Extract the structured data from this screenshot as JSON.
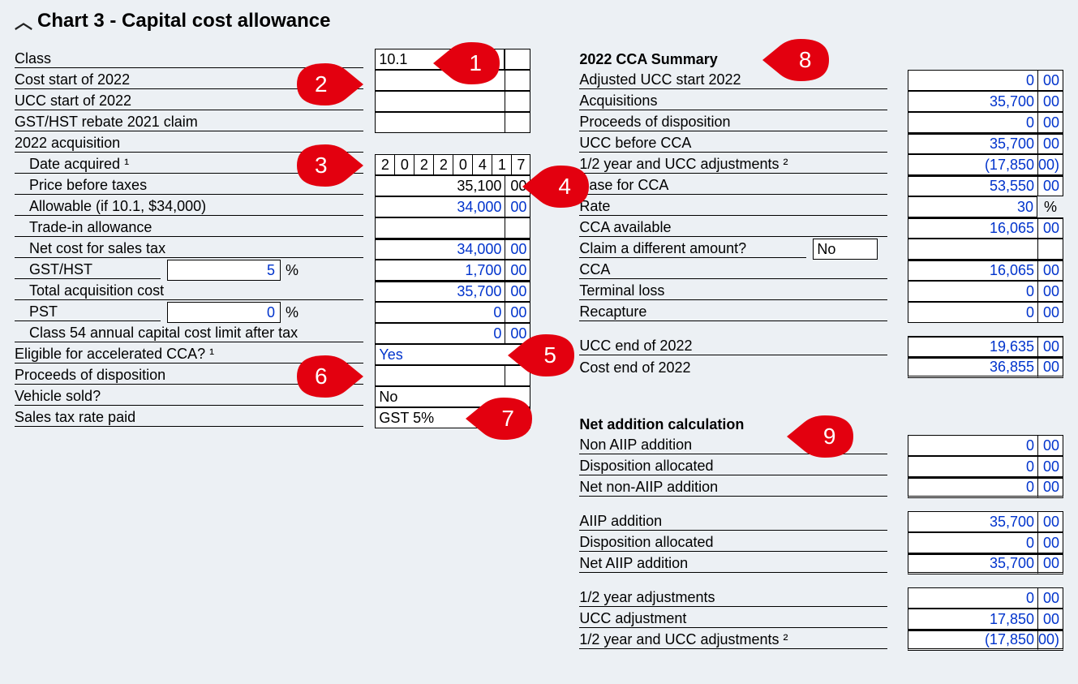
{
  "title": "Chart 3 - Capital cost allowance",
  "left": {
    "class": {
      "label": "Class",
      "value": "10.1"
    },
    "cost_start": {
      "label": "Cost start of 2022",
      "value": "",
      "cents": ""
    },
    "ucc_start": {
      "label": "UCC start of 2022",
      "value": "",
      "cents": ""
    },
    "gst_rebate": {
      "label": "GST/HST rebate 2021 claim",
      "value": "",
      "cents": ""
    },
    "acq_header": "2022 acquisition",
    "date_acquired": {
      "label": "Date acquired ¹",
      "digits": [
        "2",
        "0",
        "2",
        "2",
        "0",
        "4",
        "1",
        "7"
      ]
    },
    "price": {
      "label": "Price before taxes",
      "value": "35,100",
      "cents": "00"
    },
    "allowable": {
      "label": "Allowable (if 10.1, $34,000)",
      "value": "34,000",
      "cents": "00"
    },
    "tradein": {
      "label": "Trade-in allowance",
      "value": "",
      "cents": ""
    },
    "netcost": {
      "label": "Net cost for sales tax",
      "value": "34,000",
      "cents": "00"
    },
    "gsthst": {
      "label": "GST/HST",
      "pct": "5",
      "value": "1,700",
      "cents": "00"
    },
    "totalacq": {
      "label": "Total acquisition cost",
      "value": "35,700",
      "cents": "00"
    },
    "pst": {
      "label": "PST",
      "pct": "0",
      "value": "0",
      "cents": "00"
    },
    "class54": {
      "label": "Class 54 annual capital cost limit after tax",
      "value": "0",
      "cents": "00"
    },
    "eligible": {
      "label": "Eligible for accelerated CCA? ¹",
      "value": "Yes"
    },
    "proceeds": {
      "label": "Proceeds of disposition",
      "value": "",
      "cents": ""
    },
    "sold": {
      "label": "Vehicle sold?",
      "value": "No"
    },
    "taxrate": {
      "label": "Sales tax rate paid",
      "value": "GST 5%"
    }
  },
  "right": {
    "summary_title": "2022 CCA Summary",
    "adj_ucc": {
      "label": "Adjusted UCC start 2022",
      "value": "0",
      "cents": "00"
    },
    "acquisitions": {
      "label": "Acquisitions",
      "value": "35,700",
      "cents": "00"
    },
    "proceeds": {
      "label": "Proceeds of disposition",
      "value": "0",
      "cents": "00"
    },
    "ucc_before": {
      "label": "UCC before CCA",
      "value": "35,700",
      "cents": "00"
    },
    "half_year": {
      "label": "1/2 year and UCC adjustments ²",
      "value": "(17,850",
      "cents": "00)"
    },
    "base": {
      "label": "Base for CCA",
      "value": "53,550",
      "cents": "00"
    },
    "rate": {
      "label": "Rate",
      "value": "30",
      "pct": "%"
    },
    "cca_avail": {
      "label": "CCA available",
      "value": "16,065",
      "cents": "00"
    },
    "claim_diff": {
      "label": "Claim a different amount?",
      "value": "No"
    },
    "cca": {
      "label": "CCA",
      "value": "16,065",
      "cents": "00"
    },
    "terminal": {
      "label": "Terminal loss",
      "value": "0",
      "cents": "00"
    },
    "recapture": {
      "label": "Recapture",
      "value": "0",
      "cents": "00"
    },
    "ucc_end": {
      "label": "UCC end of 2022",
      "value": "19,635",
      "cents": "00"
    },
    "cost_end": {
      "label": "Cost end of 2022",
      "value": "36,855",
      "cents": "00"
    },
    "net_title": "Net addition calculation",
    "non_aiip": {
      "label": "Non AIIP addition",
      "value": "0",
      "cents": "00"
    },
    "disp_alloc1": {
      "label": "Disposition allocated",
      "value": "0",
      "cents": "00"
    },
    "net_non_aiip": {
      "label": "Net non-AIIP addition",
      "value": "0",
      "cents": "00"
    },
    "aiip": {
      "label": "AIIP addition",
      "value": "35,700",
      "cents": "00"
    },
    "disp_alloc2": {
      "label": "Disposition allocated",
      "value": "0",
      "cents": "00"
    },
    "net_aiip": {
      "label": "Net AIIP addition",
      "value": "35,700",
      "cents": "00"
    },
    "half_adj": {
      "label": "1/2 year adjustments",
      "value": "0",
      "cents": "00"
    },
    "ucc_adj": {
      "label": "UCC adjustment",
      "value": "17,850",
      "cents": "00"
    },
    "half_ucc_adj": {
      "label": "1/2 year and UCC adjustments ²",
      "value": "(17,850",
      "cents": "00)"
    }
  },
  "callouts": {
    "c1": "1",
    "c2": "2",
    "c3": "3",
    "c4": "4",
    "c5": "5",
    "c6": "6",
    "c7": "7",
    "c8": "8",
    "c9": "9"
  }
}
